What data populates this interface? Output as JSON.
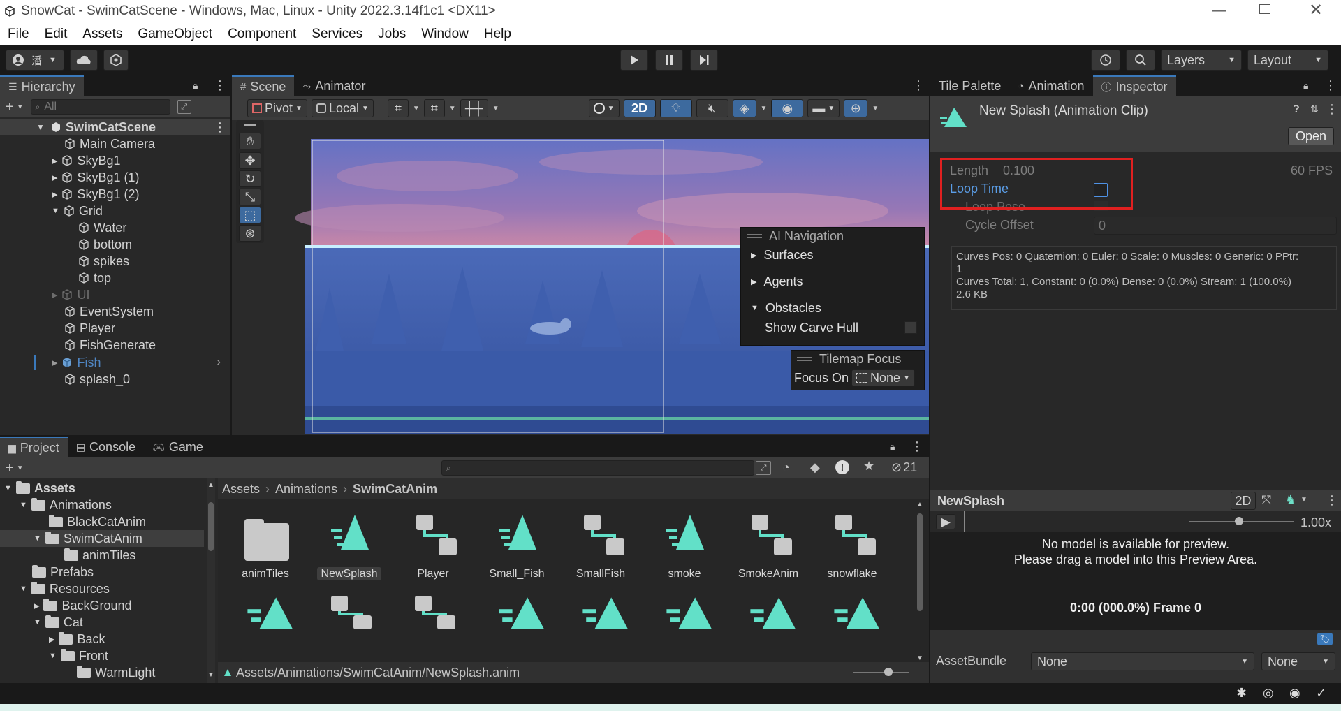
{
  "window": {
    "title": "SnowCat - SwimCatScene - Windows, Mac, Linux - Unity 2022.3.14f1c1 <DX11>"
  },
  "menu": [
    "File",
    "Edit",
    "Assets",
    "GameObject",
    "Component",
    "Services",
    "Jobs",
    "Window",
    "Help"
  ],
  "toolbar": {
    "layers": "Layers",
    "layout": "Layout"
  },
  "hierarchy": {
    "tab": "Hierarchy",
    "search_placeholder": "All",
    "scene": "SwimCatScene",
    "items": [
      "Main Camera",
      "SkyBg1",
      "SkyBg1 (1)",
      "SkyBg1 (2)",
      "Grid",
      "Water",
      "bottom",
      "spikes",
      "top",
      "UI",
      "EventSystem",
      "Player",
      "FishGenerate",
      "Fish",
      "splash_0"
    ]
  },
  "scene": {
    "tabs": [
      "Scene",
      "Animator"
    ],
    "pivot": "Pivot",
    "local": "Local",
    "mode_2d": "2D",
    "ai_nav": {
      "title": "AI Navigation",
      "surfaces": "Surfaces",
      "agents": "Agents",
      "obstacles": "Obstacles",
      "show_carve": "Show Carve Hull"
    },
    "tilemap": {
      "title": "Tilemap Focus",
      "focus_on": "Focus On",
      "value": "None"
    }
  },
  "inspector": {
    "tabs": [
      "Tile Palette",
      "Animation",
      "Inspector"
    ],
    "title": "New Splash (Animation Clip)",
    "open": "Open",
    "length_label": "Length",
    "length_value": "0.100",
    "fps": "60 FPS",
    "loop_time": "Loop Time",
    "loop_pose": "Loop Pose",
    "cycle_offset": "Cycle Offset",
    "cycle_value": "0",
    "info_lines": [
      "Curves Pos: 0 Quaternion: 0 Euler: 0 Scale: 0 Muscles: 0 Generic: 0 PPtr:",
      "1",
      "Curves Total: 1, Constant: 0 (0.0%) Dense: 0 (0.0%) Stream: 1 (100.0%)",
      "2.6 KB"
    ],
    "preview": {
      "name": "NewSplash",
      "mode": "2D",
      "speed": "1.00x",
      "msg1": "No model is available for preview.",
      "msg2": "Please drag a model into this Preview Area.",
      "time": "0:00 (000.0%) Frame 0"
    },
    "assetbundle": {
      "label": "AssetBundle",
      "value1": "None",
      "value2": "None"
    }
  },
  "project": {
    "tabs": [
      "Project",
      "Console",
      "Game"
    ],
    "hidden_count": "21",
    "tree": [
      {
        "label": "Assets",
        "level": 0,
        "arrow": "down"
      },
      {
        "label": "Animations",
        "level": 1,
        "arrow": "down"
      },
      {
        "label": "BlackCatAnim",
        "level": 2,
        "arrow": ""
      },
      {
        "label": "SwimCatAnim",
        "level": 2,
        "arrow": "down"
      },
      {
        "label": "animTiles",
        "level": 3,
        "arrow": ""
      },
      {
        "label": "Prefabs",
        "level": 1,
        "arrow": ""
      },
      {
        "label": "Resources",
        "level": 1,
        "arrow": "down"
      },
      {
        "label": "BackGround",
        "level": 2,
        "arrow": "right"
      },
      {
        "label": "Cat",
        "level": 2,
        "arrow": "down"
      },
      {
        "label": "Back",
        "level": 3,
        "arrow": "right"
      },
      {
        "label": "Front",
        "level": 3,
        "arrow": "down"
      },
      {
        "label": "WarmLight",
        "level": 4,
        "arrow": ""
      }
    ],
    "breadcrumb": [
      "Assets",
      "Animations",
      "SwimCatAnim"
    ],
    "assets": [
      {
        "name": "animTiles",
        "kind": "folder"
      },
      {
        "name": "NewSplash",
        "kind": "clip"
      },
      {
        "name": "Player",
        "kind": "controller"
      },
      {
        "name": "Small_Fish",
        "kind": "clip"
      },
      {
        "name": "SmallFish",
        "kind": "controller"
      },
      {
        "name": "smoke",
        "kind": "clip"
      },
      {
        "name": "SmokeAnim",
        "kind": "controller"
      },
      {
        "name": "snowflake",
        "kind": "controller"
      }
    ],
    "status_path": "Assets/Animations/SwimCatAnim/NewSplash.anim"
  }
}
